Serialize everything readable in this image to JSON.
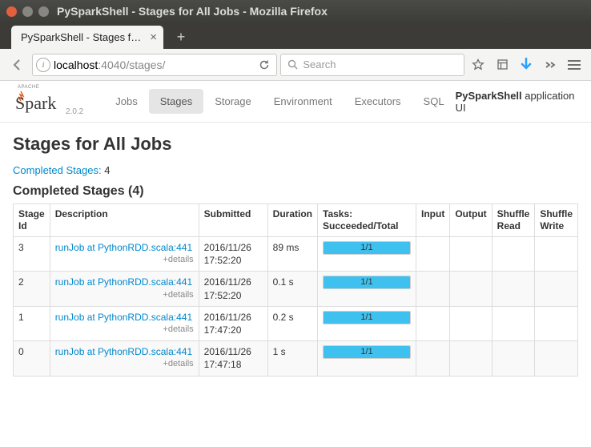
{
  "window": {
    "title": "PySparkShell - Stages for All Jobs - Mozilla Firefox"
  },
  "browser": {
    "tab_label": "PySparkShell - Stages f…",
    "url_host": "localhost",
    "url_port": ":4040",
    "url_path": "/stages/",
    "search_placeholder": "Search"
  },
  "spark": {
    "logo_small": "APACHE",
    "logo_text": "Spark",
    "version": "2.0.2",
    "tabs": {
      "jobs": "Jobs",
      "stages": "Stages",
      "storage": "Storage",
      "environment": "Environment",
      "executors": "Executors",
      "sql": "SQL"
    },
    "app_name": "PySparkShell",
    "app_suffix": " application UI"
  },
  "page": {
    "heading": "Stages for All Jobs",
    "summary_label": "Completed Stages:",
    "summary_count": " 4",
    "section_title": "Completed Stages (4)",
    "details_label": "+details",
    "columns": {
      "stage_id": "Stage Id",
      "description": "Description",
      "submitted": "Submitted",
      "duration": "Duration",
      "tasks": "Tasks: Succeeded/Total",
      "input": "Input",
      "output": "Output",
      "shuffle_read": "Shuffle Read",
      "shuffle_write": "Shuffle Write"
    },
    "rows": [
      {
        "id": "3",
        "desc": "runJob at PythonRDD.scala:441",
        "submitted": "2016/11/26 17:52:20",
        "duration": "89 ms",
        "tasks": "1/1",
        "pct": 100
      },
      {
        "id": "2",
        "desc": "runJob at PythonRDD.scala:441",
        "submitted": "2016/11/26 17:52:20",
        "duration": "0.1 s",
        "tasks": "1/1",
        "pct": 100
      },
      {
        "id": "1",
        "desc": "runJob at PythonRDD.scala:441",
        "submitted": "2016/11/26 17:47:20",
        "duration": "0.2 s",
        "tasks": "1/1",
        "pct": 100
      },
      {
        "id": "0",
        "desc": "runJob at PythonRDD.scala:441",
        "submitted": "2016/11/26 17:47:18",
        "duration": "1 s",
        "tasks": "1/1",
        "pct": 100
      }
    ]
  }
}
